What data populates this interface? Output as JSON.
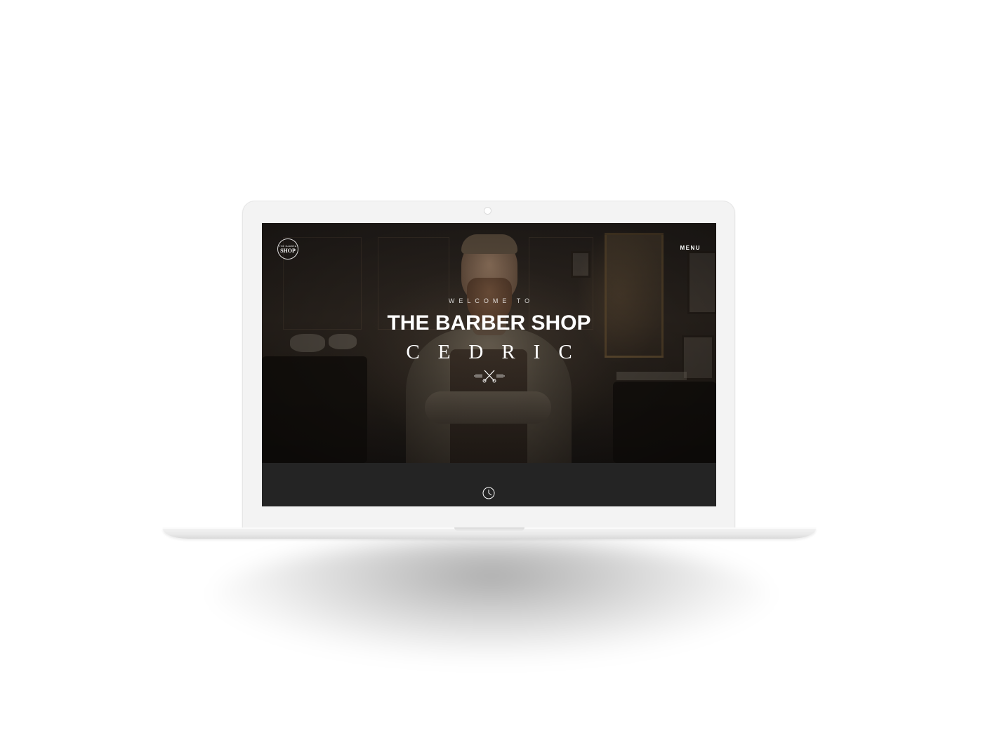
{
  "site": {
    "logo": {
      "small_text": "THE BARBER",
      "big_text": "SHOP"
    },
    "menu_label": "MENU"
  },
  "hero": {
    "welcome": "WELCOME TO",
    "title": "THE BARBER SHOP",
    "name": "CEDRIC",
    "emblem_icon": "scissors-comb-icon"
  },
  "footer_bar": {
    "icon": "clock-icon"
  },
  "colors": {
    "hero_overlay": "#2a231d",
    "bottom_bar": "#242424",
    "text": "#ffffff",
    "device": "#f3f3f3"
  }
}
